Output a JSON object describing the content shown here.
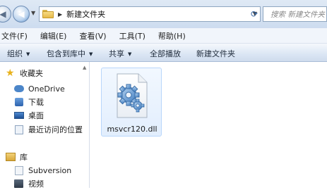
{
  "address": {
    "path_segment": "新建文件夹",
    "search_placeholder": "搜索 新建文件夹"
  },
  "menu": [
    "文件(F)",
    "编辑(E)",
    "查看(V)",
    "工具(T)",
    "帮助(H)"
  ],
  "toolbar": {
    "organize": "组织",
    "include_library": "包含到库中",
    "share": "共享",
    "burn": "全部播放",
    "new_folder": "新建文件夹"
  },
  "nav": {
    "favorites": "收藏夹",
    "onedrive": "OneDrive",
    "downloads": "下载",
    "desktop": "桌面",
    "recent": "最近访问的位置",
    "libraries": "库",
    "subversion": "Subversion",
    "videos": "视频"
  },
  "files": [
    {
      "name": "msvcr120.dll",
      "icon": "dll-gear-icon"
    }
  ]
}
